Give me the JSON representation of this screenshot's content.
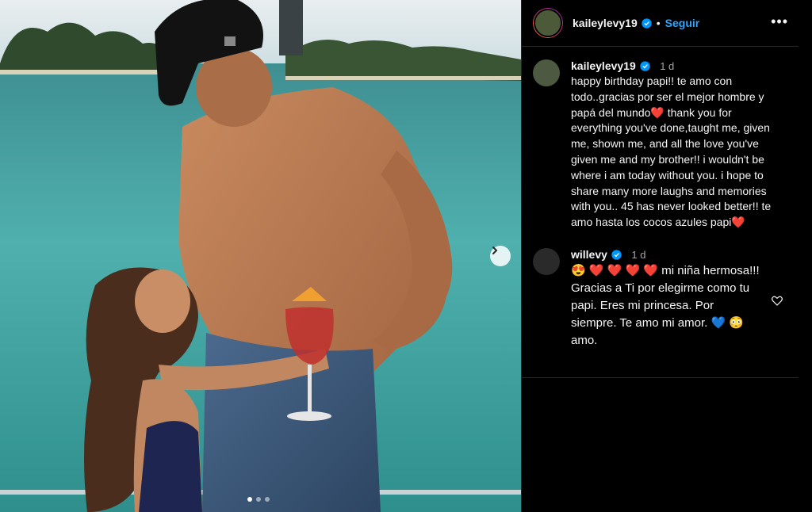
{
  "post": {
    "author": "kaileylevy19",
    "separator": "•",
    "follow_label": "Seguir",
    "more_label": "•••",
    "carousel": {
      "total": 3,
      "active": 1
    }
  },
  "caption": {
    "user": "kaileylevy19",
    "time": "1 d",
    "text_part1": "happy birthday papi!! te amo con todo..gracias por ser el mejor hombre y papá del mundo",
    "heart1": "❤️",
    "text_part2": " thank you for everything you've done,taught me, given me, shown me, and all the love you've given me and my brother!! i wouldn't be where i am today without you. i hope to share many more laughs and memories with you.. 45 has never looked better!! te amo hasta los cocos azules papi",
    "heart2": "❤️"
  },
  "reply": {
    "user": "willevy",
    "time": "1 d",
    "emojis": "😍 ❤️ ❤️ ❤️ ❤️",
    "text_part1": " mi niña hermosa!!! Gracias a Ti por elegirme como tu papi. Eres mi princesa. Por siempre. Te amo mi amor. ",
    "emoji_blue": "💙",
    "emoji_blush": "😳",
    "text_part2": " amo."
  },
  "icons": {
    "verified": "verified-badge-icon",
    "next": "chevron-right-icon",
    "like": "heart-outline-icon"
  },
  "colors": {
    "verified": "#0095f6",
    "follow": "#2ea6ff",
    "heart": "#e41b2a"
  }
}
